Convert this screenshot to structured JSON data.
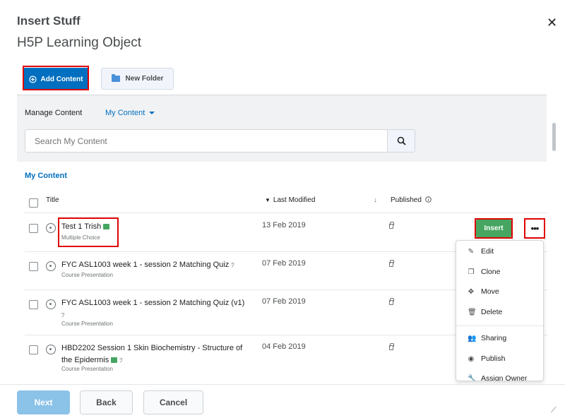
{
  "dialog": {
    "title": "Insert Stuff",
    "subtitle": "H5P Learning Object",
    "close_glyph": "✕"
  },
  "toolbar": {
    "add_content_label": "Add Content",
    "new_folder_label": "New Folder"
  },
  "manage": {
    "label": "Manage Content",
    "dropdown_value": "My Content",
    "search_placeholder": "Search My Content"
  },
  "section_title": "My Content",
  "table": {
    "headers": {
      "title": "Title",
      "last_modified": "Last Modified",
      "published": "Published"
    },
    "rows": [
      {
        "title": "Test 1 Trish",
        "type": "Multiple Choice",
        "date": "13 Feb 2019"
      },
      {
        "title": "FYC ASL1003 week 1 - session 2 Matching Quiz",
        "type": "Course Presentation",
        "date": "07 Feb 2019"
      },
      {
        "title": "FYC ASL1003 week 1 - session 2 Matching Quiz (v1)",
        "type": "Course Presentation",
        "date": "07 Feb 2019"
      },
      {
        "title": "HBD2202 Session 1 Skin Biochemistry - Structure of the Epidermis",
        "type": "Course Presentation",
        "date": "04 Feb 2019"
      }
    ]
  },
  "row_actions": {
    "insert_label": "Insert",
    "more_label": "•••"
  },
  "menu": {
    "items": [
      "Edit",
      "Clone",
      "Move",
      "Delete",
      "Sharing",
      "Publish",
      "Assign Owner"
    ],
    "icons": [
      "pencil-icon",
      "clone-icon",
      "move-icon",
      "trash-icon",
      "sharing-icon",
      "eye-icon",
      "wrench-icon"
    ]
  },
  "footer": {
    "next_label": "Next",
    "back_label": "Back",
    "cancel_label": "Cancel"
  },
  "colors": {
    "primary": "#006fbf",
    "insert_green": "#46a661",
    "highlight_red": "#e00000"
  }
}
